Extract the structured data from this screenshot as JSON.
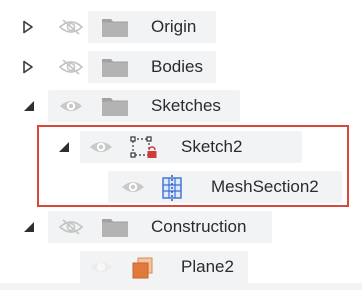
{
  "browser_tree": {
    "items": [
      {
        "label": "Origin",
        "expanded": false,
        "visible": false,
        "icon": "folder-icon"
      },
      {
        "label": "Bodies",
        "expanded": false,
        "visible": false,
        "icon": "folder-icon"
      },
      {
        "label": "Sketches",
        "expanded": true,
        "visible": true,
        "icon": "folder-icon"
      },
      {
        "label": "Sketch2",
        "expanded": true,
        "visible": true,
        "icon": "sketch-icon"
      },
      {
        "label": "MeshSection2",
        "visible": true,
        "icon": "mesh-section-icon"
      },
      {
        "label": "Construction",
        "expanded": true,
        "visible": false,
        "icon": "folder-icon"
      },
      {
        "label": "Plane2",
        "visible": false,
        "icon": "plane-icon"
      }
    ]
  },
  "colors": {
    "highlight": "#d9483b",
    "folder": "#9a9a9a",
    "plane": "#e07a3a",
    "mesh": "#3a6fd8",
    "sketch_lock": "#d03a3a"
  }
}
